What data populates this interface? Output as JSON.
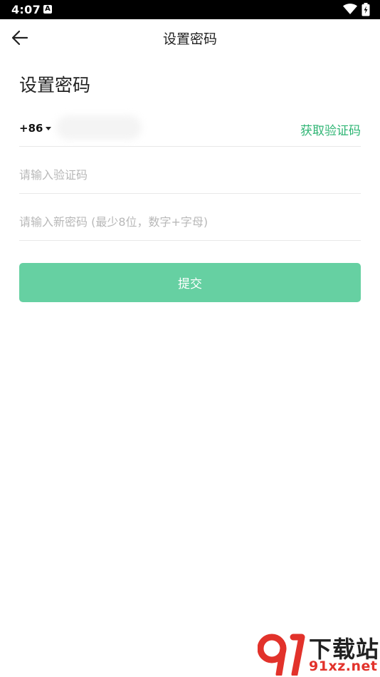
{
  "status_bar": {
    "time": "4:07",
    "notification_icon_letter": "A",
    "icons": [
      "wifi-icon",
      "battery-charging-icon"
    ]
  },
  "app_bar": {
    "back_icon": "arrow-left-icon",
    "title": "设置密码"
  },
  "form": {
    "heading": "设置密码",
    "country_code": "+86",
    "get_code_label": "获取验证码",
    "code_placeholder": "请输入验证码",
    "password_placeholder": "请输入新密码 (最少8位，数字+字母)",
    "submit_label": "提交"
  },
  "watermark": {
    "logo_text": "91",
    "name": "下载站",
    "url": "91xz.net"
  },
  "colors": {
    "accent_text": "#2fb574",
    "button_bg": "#66d0a2",
    "watermark_red": "#e2322b"
  }
}
